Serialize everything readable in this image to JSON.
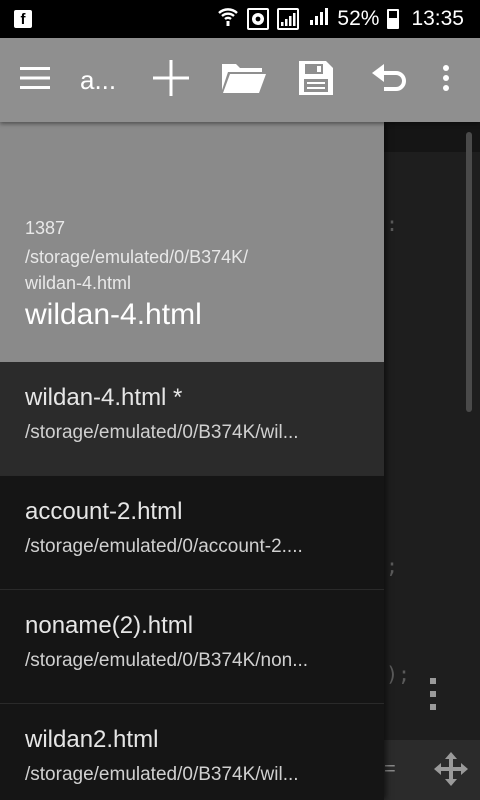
{
  "status_bar": {
    "battery_percent": "52%",
    "time": "13:35",
    "icons": [
      "facebook-icon",
      "wifi-icon",
      "vpn-icon",
      "signal-sim1-icon",
      "signal-sim2-icon",
      "battery-icon"
    ],
    "battery_level": 0.52
  },
  "toolbar": {
    "title": "a...",
    "icons": [
      "menu-icon",
      "add-icon",
      "folder-open-icon",
      "save-icon",
      "undo-icon",
      "more-vert-icon"
    ]
  },
  "drawer": {
    "header": {
      "size": "1387",
      "path": "/storage/emulated/0/B374K/\nwildan-4.html",
      "filename": "wildan-4.html"
    },
    "files": [
      {
        "name": "wildan-4.html *",
        "path": "/storage/emulated/0/B374K/wil...",
        "active": true
      },
      {
        "name": "account-2.html",
        "path": "/storage/emulated/0/account-2....",
        "active": false
      },
      {
        "name": "noname(2).html",
        "path": "/storage/emulated/0/B374K/non...",
        "active": false
      },
      {
        "name": "wildan2.html",
        "path": "/storage/emulated/0/B374K/wil...",
        "active": false
      }
    ]
  },
  "colors": {
    "toolbar": "#8f8f8f",
    "drawer_header": "#8a8a8a",
    "drawer_bg": "#151515",
    "active_item": "#2b2b2b"
  }
}
